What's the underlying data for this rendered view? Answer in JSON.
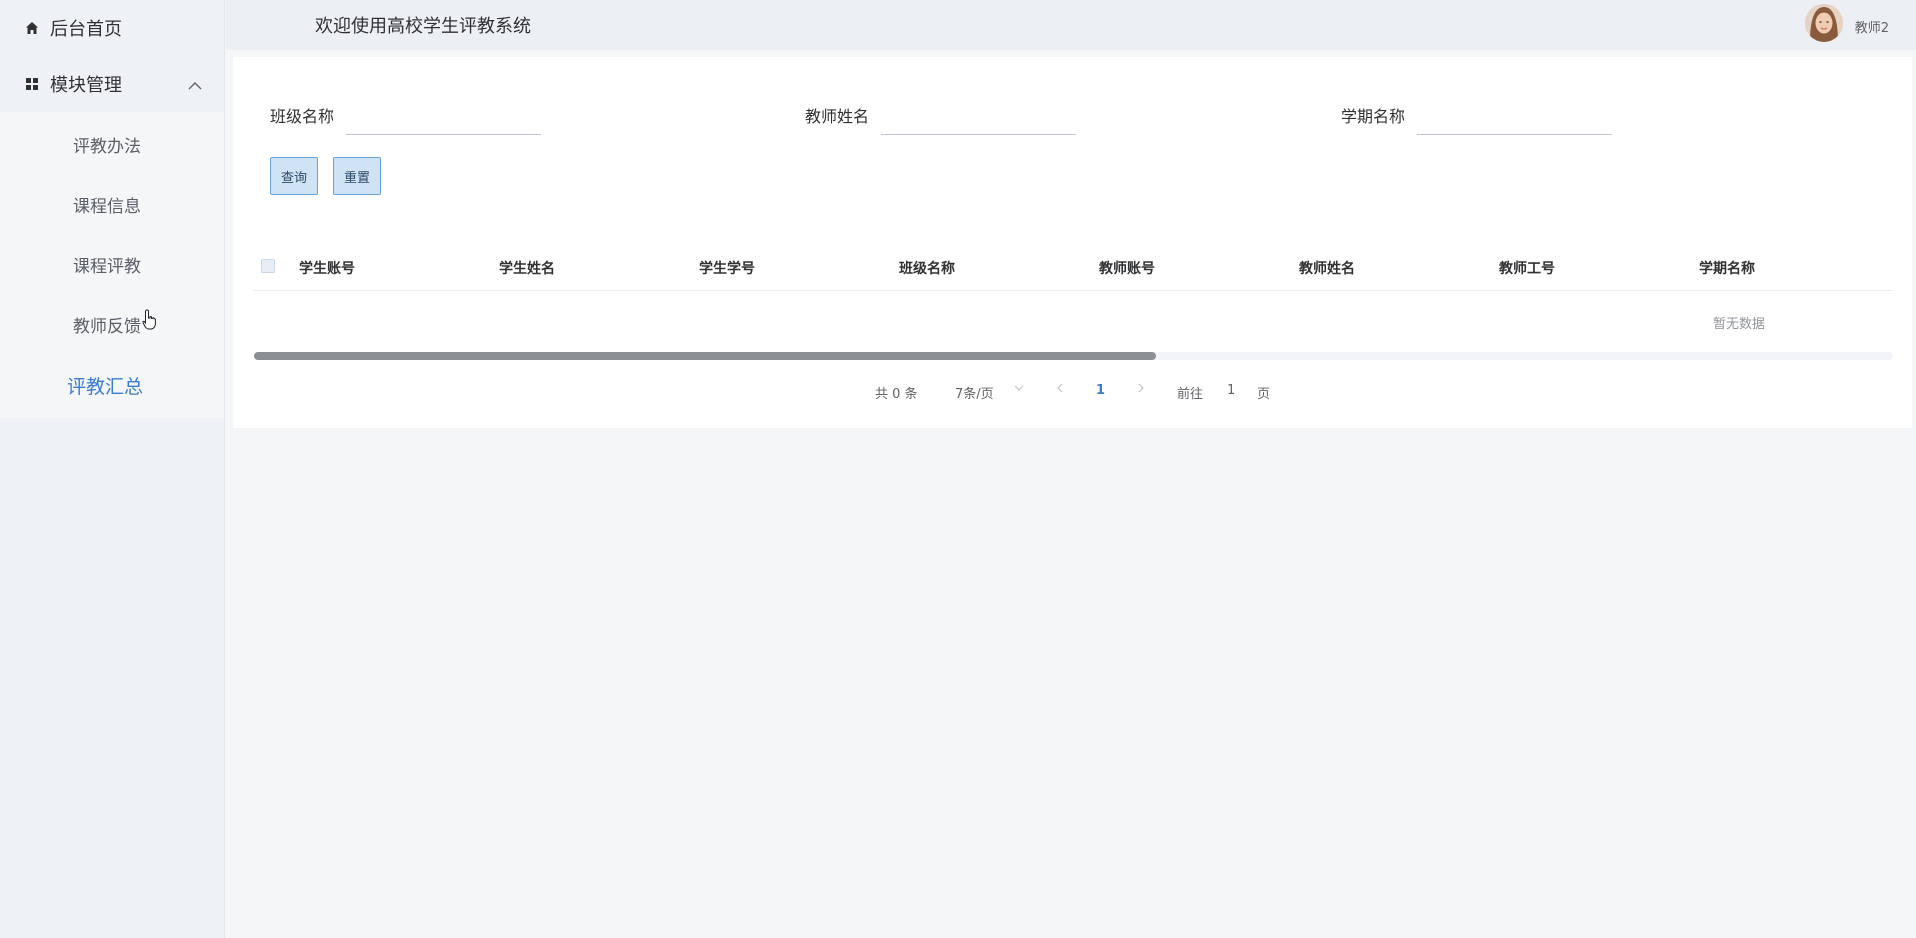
{
  "topbar": {
    "title": "欢迎使用高校学生评教系统",
    "username": "教师2"
  },
  "sidebar": {
    "home_label": "后台首页",
    "group_label": "模块管理",
    "items": [
      {
        "label": "评教办法"
      },
      {
        "label": "课程信息"
      },
      {
        "label": "课程评教"
      },
      {
        "label": "教师反馈"
      },
      {
        "label": "评教汇总"
      }
    ]
  },
  "search": {
    "class_label": "班级名称",
    "class_value": "",
    "teacher_label": "教师姓名",
    "teacher_value": "",
    "term_label": "学期名称",
    "term_value": "",
    "query_button": "查询",
    "reset_button": "重置"
  },
  "table": {
    "columns": [
      "学生账号",
      "学生姓名",
      "学生学号",
      "班级名称",
      "教师账号",
      "教师姓名",
      "教师工号",
      "学期名称"
    ],
    "empty_text": "暂无数据"
  },
  "pagination": {
    "total": "共 0 条",
    "page_size": "7条/页",
    "current_page": "1",
    "goto_label": "前往",
    "goto_value": "1",
    "page_suffix": "页"
  },
  "colors": {
    "accent": "#3b7dc8",
    "sidebar_bg": "#eef1f5",
    "button_bg": "#cfe3f4"
  }
}
